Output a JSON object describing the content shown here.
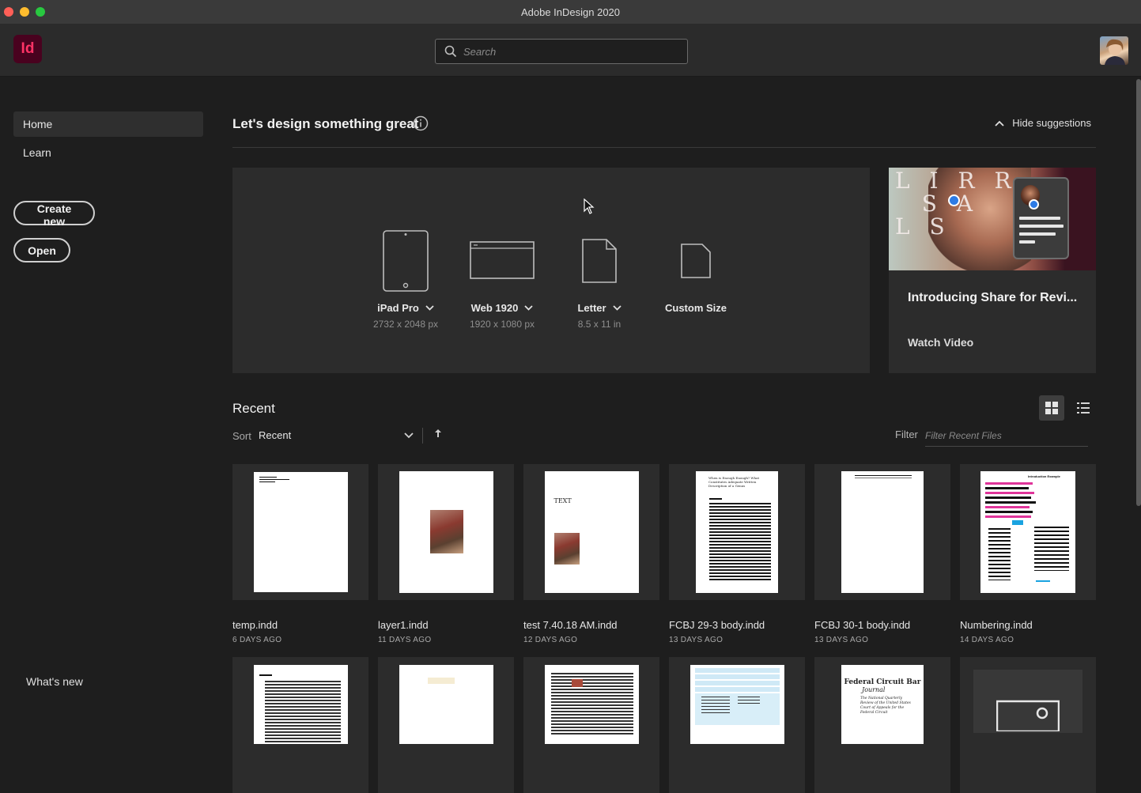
{
  "window": {
    "title": "Adobe InDesign 2020"
  },
  "app": {
    "logo": "Id"
  },
  "search": {
    "placeholder": "Search"
  },
  "sidebar": {
    "items": [
      {
        "label": "Home"
      },
      {
        "label": "Learn"
      }
    ],
    "create_new": "Create new",
    "open": "Open",
    "whats_new": "What's new"
  },
  "main": {
    "heading": "Let's design something great",
    "hide_suggestions": "Hide suggestions",
    "presets": [
      {
        "name": "iPad Pro",
        "dims": "2732 x 2048 px",
        "has_menu": true,
        "icon": "tablet-icon"
      },
      {
        "name": "Web 1920",
        "dims": "1920 x 1080 px",
        "has_menu": true,
        "icon": "browser-window-icon"
      },
      {
        "name": "Letter",
        "dims": "8.5 x 11 in",
        "has_menu": true,
        "icon": "document-icon"
      },
      {
        "name": "Custom Size",
        "dims": "",
        "has_menu": false,
        "icon": "document-icon"
      }
    ],
    "promo": {
      "title": "Introducing Share for Revi...",
      "link": "Watch Video",
      "image_letters": "LIRR\nSA\nLS"
    },
    "recent": {
      "title": "Recent",
      "sort_label": "Sort",
      "sort_value": "Recent",
      "filter_label": "Filter",
      "filter_placeholder": "Filter Recent Files",
      "files": [
        {
          "name": "temp.indd",
          "date": "6 DAYS AGO"
        },
        {
          "name": "layer1.indd",
          "date": "11 DAYS AGO"
        },
        {
          "name": "test 7.40.18 AM.indd",
          "date": "12 DAYS AGO",
          "thumb_text": "TEXT"
        },
        {
          "name": "FCBJ 29-3 body.indd",
          "date": "13 DAYS AGO",
          "thumb_text": "When is Enough Enough? What Constitutes Adequate Written Description of a Genus"
        },
        {
          "name": "FCBJ 30-1 body.indd",
          "date": "13 DAYS AGO"
        },
        {
          "name": "Numbering.indd",
          "date": "14 DAYS AGO",
          "thumb_text": "Introduction Example"
        }
      ],
      "second_row_thumb_text": {
        "journal_title": "Federal Circuit Bar",
        "journal_sub": "Journal",
        "journal_desc": "The National Quarterly Review of the United States Court of Appeals for the Federal Circuit"
      }
    }
  },
  "colors": {
    "accent": "#ff3366",
    "logo_bg": "#49021f",
    "background": "#1e1e1e",
    "panel": "#2c2c2c"
  }
}
